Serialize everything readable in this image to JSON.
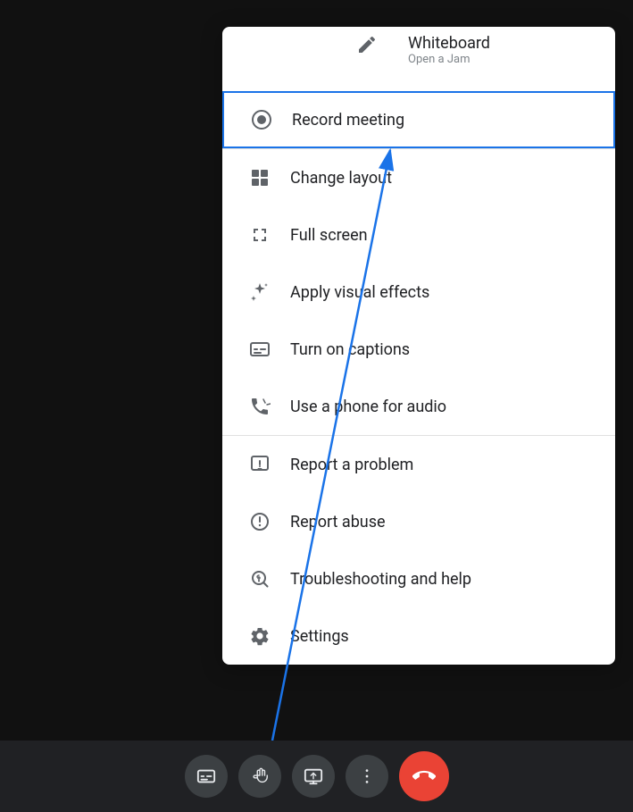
{
  "background": {
    "color": "#111111"
  },
  "menu": {
    "items": [
      {
        "id": "whiteboard",
        "label": "Whiteboard",
        "sublabel": "Open a Jam",
        "icon": "pencil",
        "highlighted": false,
        "hasSub": true
      },
      {
        "id": "record-meeting",
        "label": "Record meeting",
        "sublabel": null,
        "icon": "record",
        "highlighted": true,
        "hasSub": false
      },
      {
        "id": "change-layout",
        "label": "Change layout",
        "sublabel": null,
        "icon": "layout",
        "highlighted": false,
        "hasSub": false
      },
      {
        "id": "full-screen",
        "label": "Full screen",
        "sublabel": null,
        "icon": "fullscreen",
        "highlighted": false,
        "hasSub": false
      },
      {
        "id": "visual-effects",
        "label": "Apply visual effects",
        "sublabel": null,
        "icon": "sparkle",
        "highlighted": false,
        "hasSub": false
      },
      {
        "id": "captions",
        "label": "Turn on captions",
        "sublabel": null,
        "icon": "captions",
        "highlighted": false,
        "hasSub": false
      },
      {
        "id": "phone-audio",
        "label": "Use a phone for audio",
        "sublabel": null,
        "icon": "phone",
        "highlighted": false,
        "hasSub": false
      },
      {
        "id": "report-problem",
        "label": "Report a problem",
        "sublabel": null,
        "icon": "report",
        "highlighted": false,
        "hasSub": false
      },
      {
        "id": "report-abuse",
        "label": "Report abuse",
        "sublabel": null,
        "icon": "abuse",
        "highlighted": false,
        "hasSub": false
      },
      {
        "id": "troubleshooting",
        "label": "Troubleshooting and help",
        "sublabel": null,
        "icon": "troubleshoot",
        "highlighted": false,
        "hasSub": false
      },
      {
        "id": "settings",
        "label": "Settings",
        "sublabel": null,
        "icon": "gear",
        "highlighted": false,
        "hasSub": false
      }
    ]
  },
  "toolbar": {
    "buttons": [
      {
        "id": "captions",
        "label": "Captions"
      },
      {
        "id": "raise-hand",
        "label": "Raise hand"
      },
      {
        "id": "share-screen",
        "label": "Share screen"
      },
      {
        "id": "more-options",
        "label": "More options"
      },
      {
        "id": "end-call",
        "label": "End call"
      }
    ]
  },
  "arrow": {
    "color": "#1a73e8"
  }
}
